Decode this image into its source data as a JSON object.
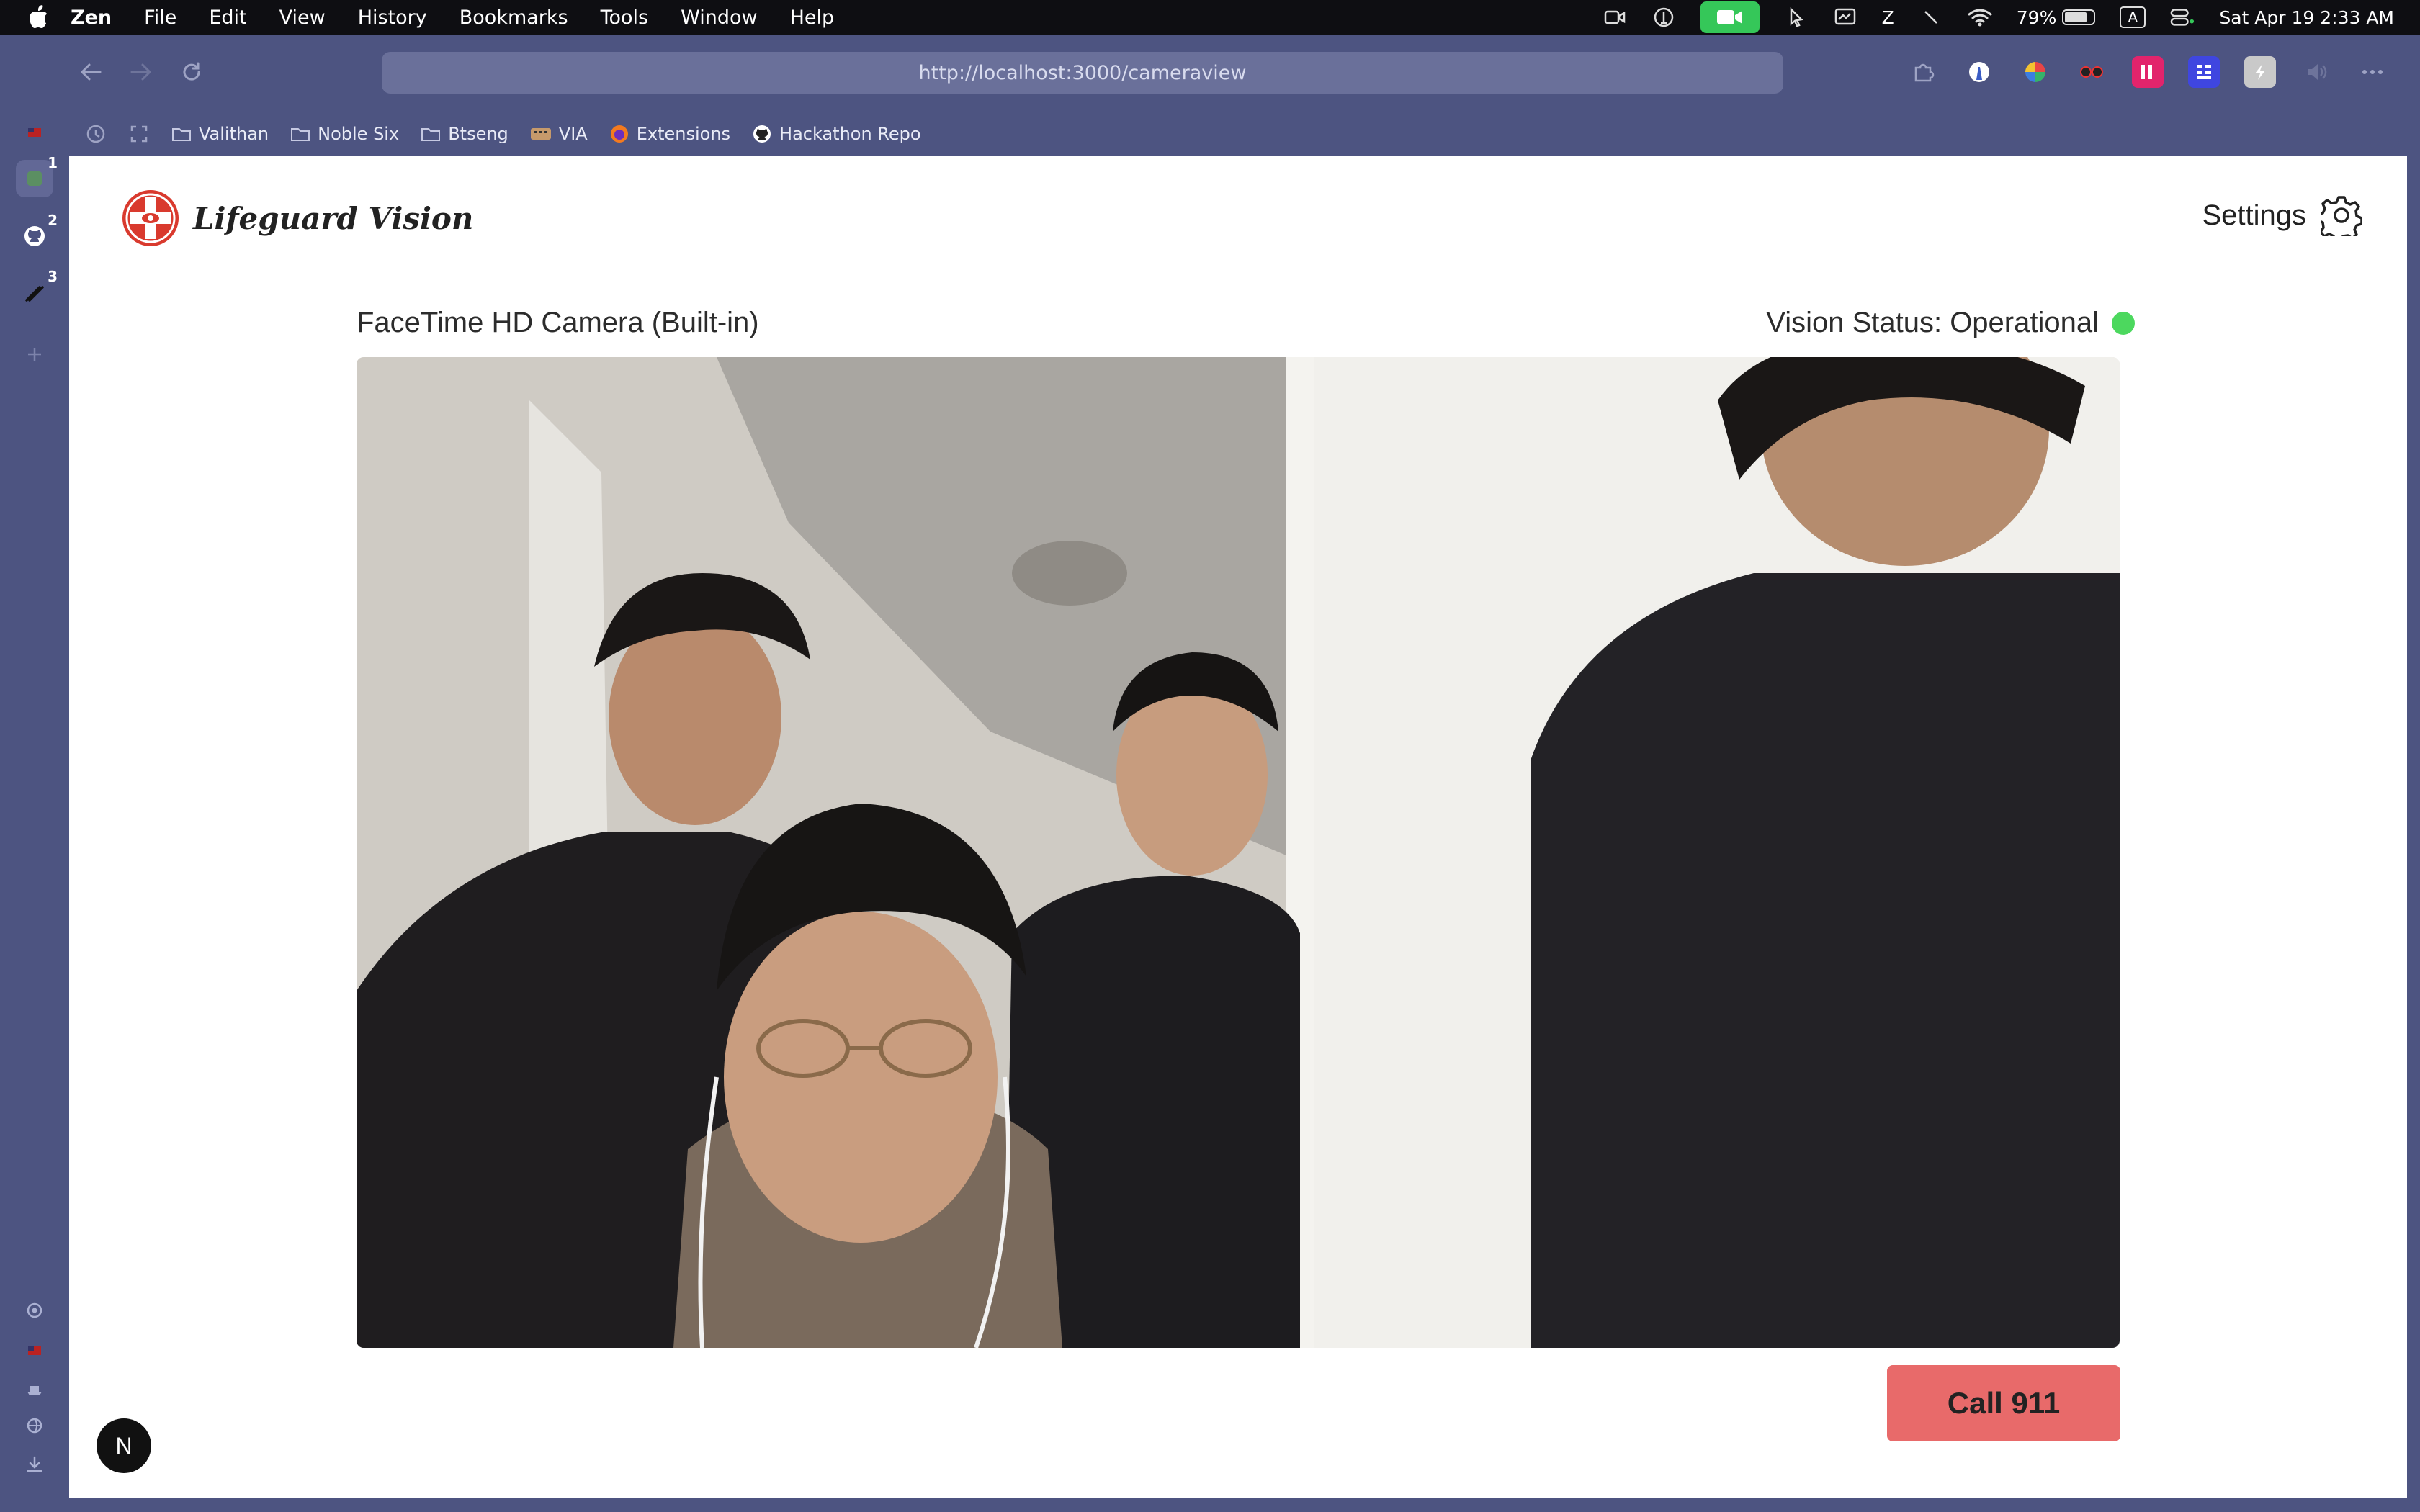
{
  "menubar": {
    "app_name": "Zen",
    "items": [
      "File",
      "Edit",
      "View",
      "History",
      "Bookmarks",
      "Tools",
      "Window",
      "Help"
    ],
    "z_label": "Z",
    "battery": "79%",
    "battery_level": 0.79,
    "keyboard_input": "A",
    "datetime": "Sat Apr 19  2:33 AM"
  },
  "browser": {
    "url": "http://localhost:3000/cameraview",
    "bookmarks": [
      "Valithan",
      "Noble Six",
      "Btseng",
      "VIA",
      "Extensions",
      "Hackathon Repo"
    ],
    "sidebar_workspaces": [
      "1",
      "2",
      "3"
    ],
    "extension_icons": [
      "puzzle-icon",
      "lighthouse-icon",
      "pinwheel-icon",
      "glasses-icon",
      "tv-icon",
      "grid-icon",
      "bolt-icon",
      "speaker-icon",
      "more-icon"
    ]
  },
  "page": {
    "brand": "Lifeguard Vision",
    "settings_label": "Settings",
    "camera_name": "FaceTime HD Camera (Built-in)",
    "vision_status": "Vision Status: Operational",
    "call_button": "Call 911",
    "next_badge": "N"
  },
  "colors": {
    "chrome": "#4d5481",
    "status_ok": "#4cd85e",
    "call_button": "#e86a6a",
    "brand_red": "#d93a2e"
  }
}
